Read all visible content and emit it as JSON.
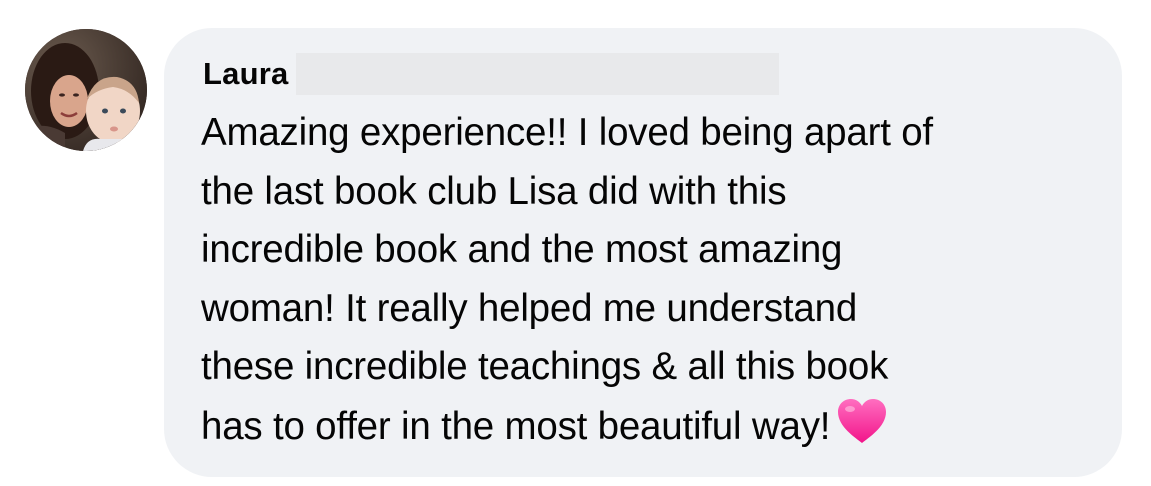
{
  "comment": {
    "author": "Laura",
    "lines": [
      "Amazing experience!! I loved being apart of",
      "the last book club Lisa did with this",
      "incredible book and the most amazing",
      "woman! It really helped me understand",
      "these incredible teachings & all this book",
      "has to offer in the most beautiful way!"
    ],
    "emoji_icon": "pink-heart-icon"
  },
  "colors": {
    "bubble_background": "#f0f2f5",
    "text": "#050505",
    "redaction": "#e8e9eb",
    "heart": "#ff3fa4"
  }
}
